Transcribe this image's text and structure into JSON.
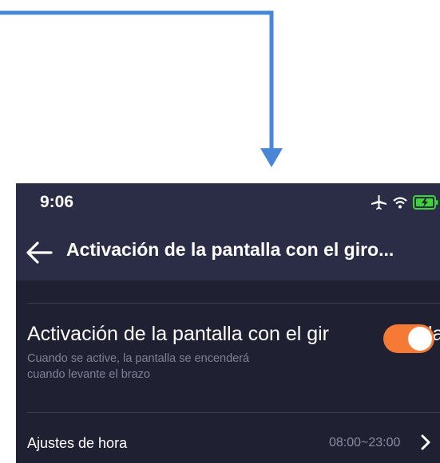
{
  "status_bar": {
    "time": "9:06",
    "icons": [
      "airplane-icon",
      "wifi-icon",
      "battery-charging-icon"
    ]
  },
  "nav": {
    "title": "Activación de la pantalla con el giro...",
    "back_icon": "back-arrow-icon"
  },
  "setting": {
    "title": "Activación de la pantalla con el gir",
    "title_overflow": "la",
    "description_line1": "Cuando se active, la pantalla se encenderá",
    "description_line2": "cuando levante el brazo",
    "toggle_on": true
  },
  "hours": {
    "label": "Ajustes de hora",
    "value": "08:00~23:00"
  },
  "colors": {
    "arrow": "#4a86d8",
    "background": "#1f2133",
    "header": "#2a2d45",
    "toggle": "#f47a36",
    "battery": "#3fd23a"
  }
}
